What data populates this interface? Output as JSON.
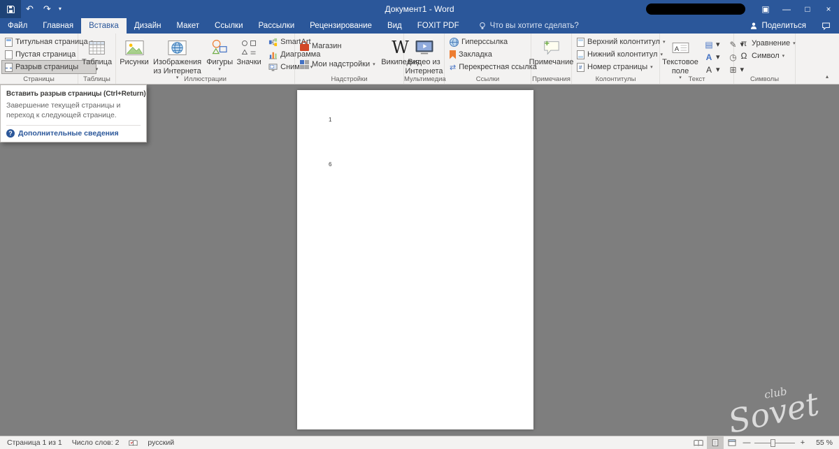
{
  "titlebar": {
    "title": "Документ1 - Word"
  },
  "tabbar": {
    "file": "Файл",
    "home": "Главная",
    "insert": "Вставка",
    "design": "Дизайн",
    "layout": "Макет",
    "references": "Ссылки",
    "mailings": "Рассылки",
    "review": "Рецензирование",
    "view": "Вид",
    "foxit": "FOXIT PDF",
    "tell_me": "Что вы хотите сделать?",
    "share": "Поделиться"
  },
  "ribbon": {
    "pages": {
      "label": "Страницы",
      "cover": "Титульная страница",
      "blank": "Пустая страница",
      "break": "Разрыв страницы"
    },
    "tables": {
      "label": "Таблицы",
      "table": "Таблица"
    },
    "illustrations": {
      "label": "Иллюстрации",
      "pictures": "Рисунки",
      "online_pictures": "Изображения из Интернета",
      "shapes": "Фигуры",
      "icons": "Значки",
      "smartart": "SmartArt",
      "chart": "Диаграмма",
      "screenshot": "Снимок"
    },
    "addins": {
      "label": "Надстройки",
      "store": "Магазин",
      "my_addins": "Мои надстройки",
      "wikipedia": "Википедия"
    },
    "media": {
      "label": "Мультимедиа",
      "online_video": "Видео из Интернета"
    },
    "links": {
      "label": "Ссылки",
      "hyperlink": "Гиперссылка",
      "bookmark": "Закладка",
      "crossref": "Перекрестная ссылка"
    },
    "comments": {
      "label": "Примечания",
      "comment": "Примечание"
    },
    "header_footer": {
      "label": "Колонтитулы",
      "header": "Верхний колонтитул",
      "footer": "Нижний колонтитул",
      "page_number": "Номер страницы"
    },
    "text": {
      "label": "Текст",
      "text_box": "Текстовое поле"
    },
    "symbols": {
      "label": "Символы",
      "equation": "Уравнение",
      "symbol": "Символ"
    }
  },
  "tooltip": {
    "title": "Вставить разрыв страницы (Ctrl+Return)",
    "body": "Завершение текущей страницы и переход к следующей странице.",
    "more": "Дополнительные сведения"
  },
  "document": {
    "word1": "1",
    "word2": "6"
  },
  "watermark": {
    "club": "club",
    "name": "Sovet"
  },
  "statusbar": {
    "page": "Страница 1 из 1",
    "words": "Число слов: 2",
    "language": "русский",
    "zoom": "55 %"
  },
  "colors": {
    "titlebar_blue": "#2b579a",
    "ribbon_bg": "#f3f2f1",
    "highlight_gray": "#d2d0ce",
    "doc_bg": "#7e7e7e",
    "link_blue": "#2b579a"
  },
  "icons": {
    "save": "floppy-css-shape",
    "undo": "↶",
    "redo": "↷",
    "caret_down": "▾",
    "ribbon_options": "▣",
    "minimize": "—",
    "maximize": "□",
    "close": "×",
    "help": "?",
    "minus": "—",
    "plus": "+",
    "pi": "π",
    "omega": "Ω",
    "wikipedia_w": "W",
    "letter_a": "A",
    "quick_parts": "▤",
    "wordart": "А",
    "drop_cap": "А",
    "signature": "✎",
    "datetime": "◷",
    "object": "⊞",
    "crossref_arrows": "⇄",
    "collapse_ribbon": "▴"
  }
}
